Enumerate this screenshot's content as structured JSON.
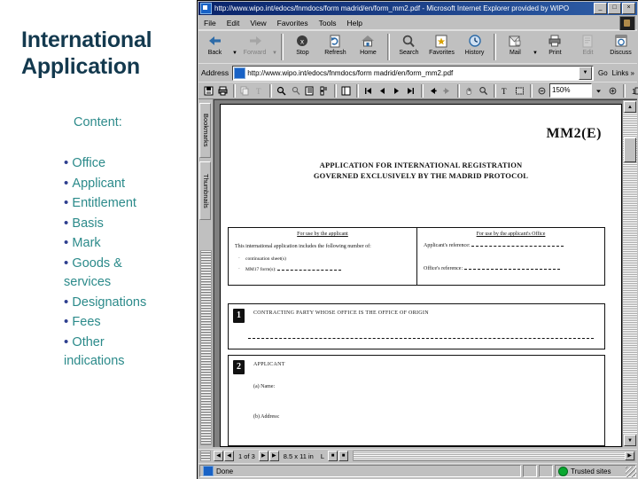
{
  "slide": {
    "title": "International Application",
    "content_label": "Content:",
    "bullets": [
      {
        "text": "Office",
        "bulleted": true
      },
      {
        "text": "Applicant",
        "bulleted": true
      },
      {
        "text": "Entitlement",
        "bulleted": true
      },
      {
        "text": "Basis",
        "bulleted": true
      },
      {
        "text": "Mark",
        "bulleted": true
      },
      {
        "text": "Goods &",
        "bulleted": true
      },
      {
        "text": "services",
        "bulleted": false
      },
      {
        "text": "Designations",
        "bulleted": true
      },
      {
        "text": "Fees",
        "bulleted": true
      },
      {
        "text": "Other",
        "bulleted": true
      },
      {
        "text": "indications",
        "bulleted": false
      }
    ],
    "colors": {
      "title": "#13394e",
      "text": "#2b8a8a",
      "bullet": "#2e3f8f"
    }
  },
  "browser": {
    "title": "http://www.wipo.int/edocs/fnmdocs/form madrid/en/form_mm2.pdf - Microsoft Internet Explorer provided by WIPO",
    "window_buttons": [
      {
        "name": "minimize",
        "glyph": "_"
      },
      {
        "name": "maximize",
        "glyph": "□"
      },
      {
        "name": "close",
        "glyph": "×"
      }
    ],
    "menu": [
      "File",
      "Edit",
      "View",
      "Favorites",
      "Tools",
      "Help"
    ],
    "toolbar": [
      {
        "label": "Back",
        "icon": "back-arrow-icon",
        "disabled": false,
        "caret": true
      },
      {
        "label": "Forward",
        "icon": "forward-arrow-icon",
        "disabled": true,
        "caret": true
      },
      {
        "label": "Stop",
        "icon": "stop-icon",
        "disabled": false,
        "caret": false
      },
      {
        "label": "Refresh",
        "icon": "refresh-icon",
        "disabled": false,
        "caret": false
      },
      {
        "label": "Home",
        "icon": "home-icon",
        "disabled": false,
        "caret": false
      },
      {
        "label": "Search",
        "icon": "search-icon",
        "disabled": false,
        "caret": false
      },
      {
        "label": "Favorites",
        "icon": "favorites-star-icon",
        "disabled": false,
        "caret": false
      },
      {
        "label": "History",
        "icon": "history-clock-icon",
        "disabled": false,
        "caret": false
      },
      {
        "label": "Mail",
        "icon": "mail-icon",
        "disabled": false,
        "caret": true
      },
      {
        "label": "Print",
        "icon": "printer-icon",
        "disabled": false,
        "caret": false
      },
      {
        "label": "Edit",
        "icon": "edit-page-icon",
        "disabled": true,
        "caret": false
      },
      {
        "label": "Discuss",
        "icon": "discuss-icon",
        "disabled": false,
        "caret": false
      }
    ],
    "address": {
      "label": "Address",
      "value": "http://www.wipo.int/edocs/fnmdocs/form madrid/en/form_mm2.pdf",
      "go_label": "Go",
      "links_label": "Links »"
    },
    "status": {
      "message": "Done",
      "zone": "Trusted sites"
    }
  },
  "acrobat": {
    "toolbar_icons": [
      "save-icon",
      "print-icon",
      "copy-icon",
      "select-text-icon",
      "find-icon",
      "search-icon",
      "bookmark-icon",
      "thumbnail-icon",
      "show-hide-navigation-icon"
    ],
    "nav_icons": [
      "first-page-icon",
      "previous-page-icon",
      "next-page-icon",
      "last-page-icon"
    ],
    "view_icons": [
      "previous-view-icon",
      "next-view-icon"
    ],
    "tool_icons": [
      "hand-tool-icon",
      "zoom-tool-icon",
      "text-select-icon",
      "graphic-select-icon"
    ],
    "zoom": {
      "value": "150%",
      "zoom-out-icon": "minus-icon",
      "zoom-in-icon": "plus-icon"
    },
    "page_layout_icons": [
      "actual-size-icon",
      "fit-page-icon",
      "fit-width-icon",
      "single-page-icon",
      "continuous-icon"
    ],
    "acrobat_logo": "acrobat-logo-icon",
    "nav_tabs": [
      "Bookmarks",
      "Thumbnails"
    ],
    "status": {
      "page": "1 of 3",
      "page_size": "8.5 x 11 in",
      "fit_label": "L"
    }
  },
  "pdf": {
    "form_code": "MM2(E)",
    "heading_line1": "APPLICATION FOR INTERNATIONAL REGISTRATION",
    "heading_line2": "GOVERNED EXCLUSIVELY BY THE MADRID PROTOCOL",
    "applicant_box": {
      "header": "For use by the applicant",
      "intro": "This international application includes the following number of:",
      "items": [
        "continuation sheet(s)",
        "MM17 form(s):"
      ]
    },
    "office_box": {
      "header": "For use by the applicant's Office",
      "fields": [
        "Applicant's reference:",
        "Office's reference:"
      ]
    },
    "sections": [
      {
        "number": "1",
        "title": "CONTRACTING PARTY WHOSE OFFICE IS THE OFFICE OF ORIGIN",
        "fields": []
      },
      {
        "number": "2",
        "title": "APPLICANT",
        "fields": [
          "(a) Name:",
          "(b) Address:"
        ]
      }
    ]
  }
}
